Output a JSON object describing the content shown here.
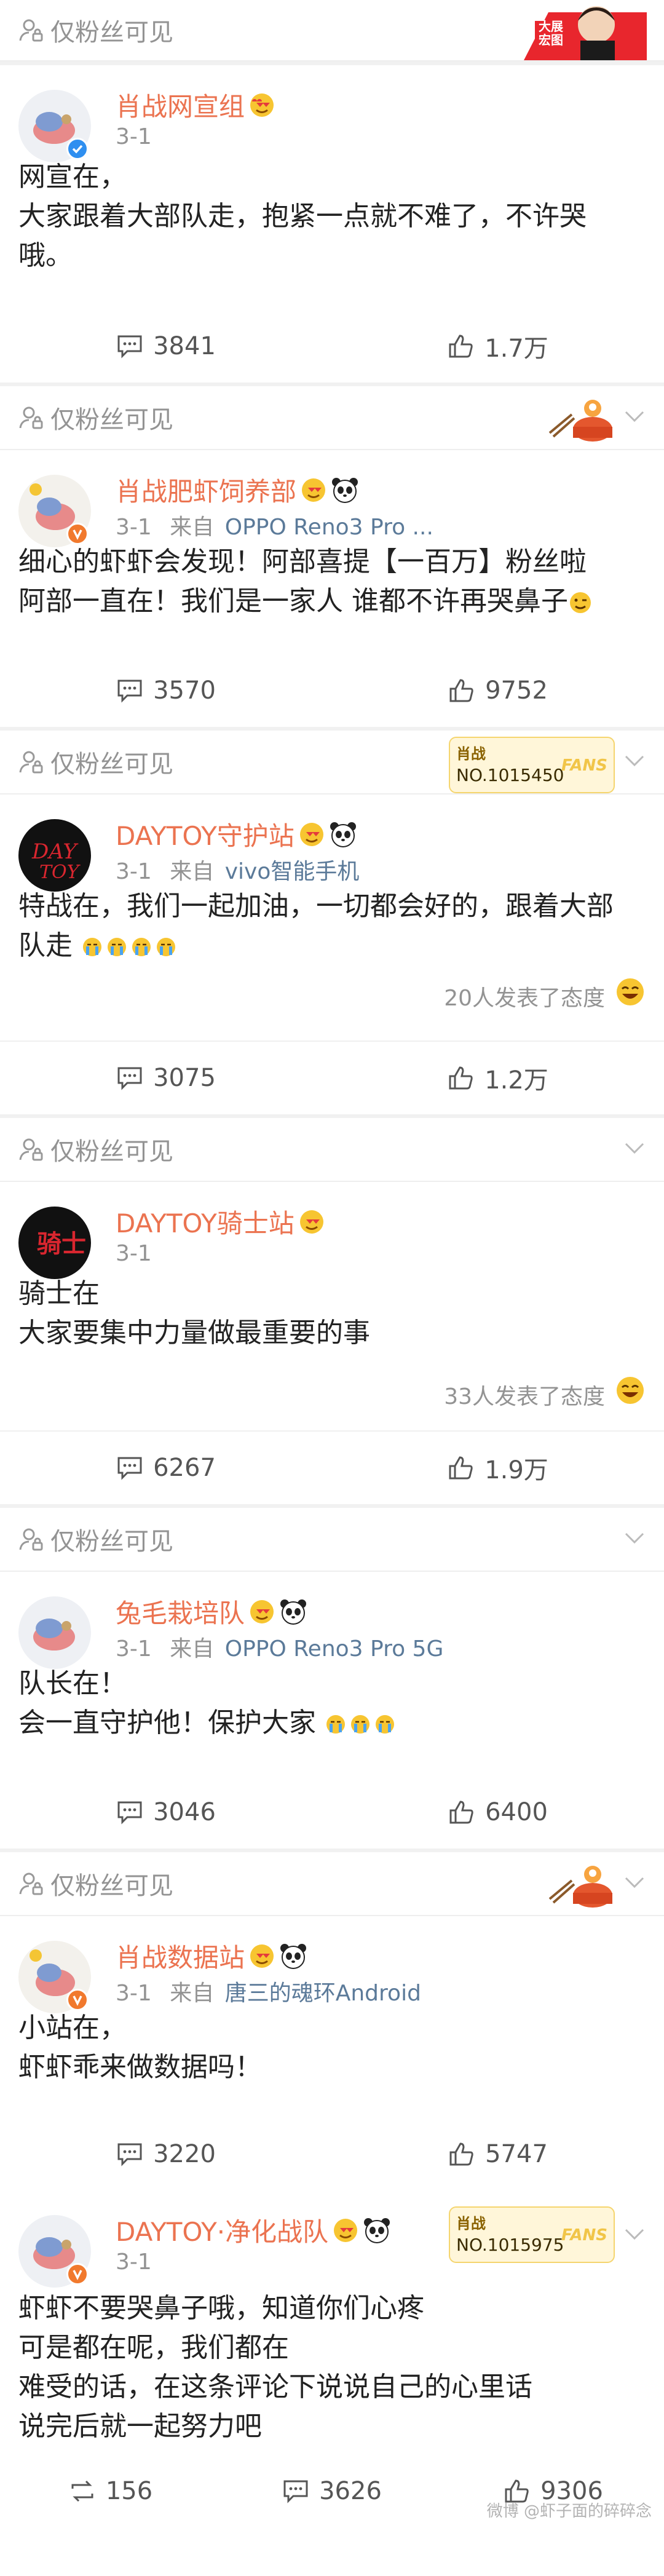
{
  "visibility_label": "仅粉丝可见",
  "top_banner": {
    "text": "大展宏图"
  },
  "posts": [
    {
      "user": "肖战网宣组",
      "date": "3-1",
      "source_prefix": "",
      "device": "",
      "text": [
        "网宣在，",
        "大家跟着大部队走，抱紧一点就不难了，不许哭",
        "哦。"
      ],
      "reactions": "",
      "comments": "3841",
      "likes": "1.7万"
    },
    {
      "user": "肖战肥虾饲养部",
      "date": "3-1",
      "source_prefix": "来自",
      "device": "OPPO Reno3 Pro ...",
      "text": [
        "细心的虾虾会发现！阿部喜提【一百万】粉丝啦",
        "阿部一直在！我们是一家人 谁都不许再哭鼻子"
      ],
      "reactions": "",
      "comments": "3570",
      "likes": "9752"
    },
    {
      "user": "DAYTOY守护站",
      "date": "3-1",
      "source_prefix": "来自",
      "device": "vivo智能手机",
      "text": [
        "特战在，我们一起加油，一切都会好的，跟着大部",
        "队走"
      ],
      "reactions": "20人发表了态度",
      "comments": "3075",
      "likes": "1.2万"
    },
    {
      "user": "DAYTOY骑士站",
      "date": "3-1",
      "source_prefix": "",
      "device": "",
      "text": [
        "骑士在",
        "大家要集中力量做最重要的事"
      ],
      "reactions": "33人发表了态度",
      "comments": "6267",
      "likes": "1.9万"
    },
    {
      "user": "兔毛栽培队",
      "date": "3-1",
      "source_prefix": "来自",
      "device": "OPPO Reno3 Pro 5G",
      "text": [
        "队长在！",
        "会一直守护他！保护大家"
      ],
      "reactions": "",
      "comments": "3046",
      "likes": "6400"
    },
    {
      "user": "肖战数据站",
      "date": "3-1",
      "source_prefix": "来自",
      "device": "唐三的魂环Android",
      "text": [
        "小站在，",
        "虾虾乖来做数据吗！"
      ],
      "reactions": "",
      "comments": "3220",
      "likes": "5747"
    },
    {
      "user": "DAYTOY·净化战队",
      "date": "3-1",
      "source_prefix": "",
      "device": "",
      "text": [
        "虾虾不要哭鼻子哦，知道你们心疼",
        "可是都在呢，我们都在",
        "难受的话，在这条评论下说说自己的心里话",
        "说完后就一起努力吧"
      ],
      "reactions": "",
      "reposts": "156",
      "comments": "3626",
      "likes": "9306"
    }
  ],
  "fans_badges": [
    {
      "title": "肖战",
      "number": "NO.1015450",
      "tag": "FANS"
    },
    {
      "title": "肖战",
      "number": "NO.1015975",
      "tag": "FANS"
    }
  ],
  "watermark": "微博 @虾子面的碎碎念",
  "colors": {
    "name": "#eb7350",
    "meta": "#939393",
    "device": "#5b7a99",
    "text": "#222222",
    "verified_blue": "#2f8ff0",
    "verified_orange": "#f1792d"
  }
}
